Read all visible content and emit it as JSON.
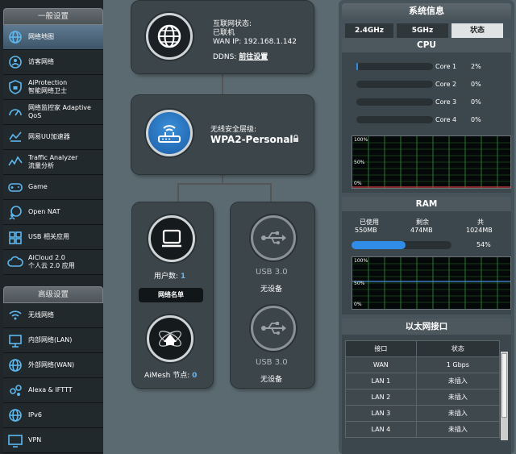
{
  "sidebar": {
    "general_header": "一般设置",
    "general_items": [
      {
        "label": "网络地图",
        "icon": "globe-icon",
        "active": true
      },
      {
        "label": "访客网络",
        "icon": "guest-network-icon"
      },
      {
        "label": "AiProtection",
        "label2": "智能网络卫士",
        "icon": "shield-lock-icon"
      },
      {
        "label": "网络监控家 Adaptive",
        "label2": "QoS",
        "icon": "gauge-icon"
      },
      {
        "label": "网易UU加速器",
        "icon": "uu-accelerator-icon"
      },
      {
        "label": "Traffic Analyzer",
        "label2": "流量分析",
        "icon": "traffic-icon"
      },
      {
        "label": "Game",
        "icon": "gamepad-icon"
      },
      {
        "label": "Open NAT",
        "icon": "globe-person-icon"
      },
      {
        "label": "USB 相关应用",
        "icon": "usb-puzzle-icon"
      },
      {
        "label": "AiCloud 2.0",
        "label2": "个人云 2.0 应用",
        "icon": "cloud-icon"
      }
    ],
    "advanced_header": "高级设置",
    "advanced_items": [
      {
        "label": "无线网络",
        "icon": "wifi-icon"
      },
      {
        "label": "内部网络(LAN)",
        "icon": "lan-icon"
      },
      {
        "label": "外部网络(WAN)",
        "icon": "wan-globe-icon"
      },
      {
        "label": "Alexa & IFTTT",
        "icon": "assistant-icon"
      },
      {
        "label": "IPv6",
        "icon": "ipv6-globe-icon"
      },
      {
        "label": "VPN",
        "icon": "vpn-monitor-icon"
      }
    ]
  },
  "internet": {
    "status_label": "互联网状态:",
    "status_value": "已联机",
    "wan_ip_label": "WAN IP:",
    "wan_ip": "192.168.1.142",
    "ddns_label": "DDNS:",
    "ddns_link": "前往设置"
  },
  "router": {
    "security_label": "无线安全层级:",
    "security_value": "WPA2-Personal"
  },
  "clients": {
    "count_label": "用户数:",
    "count": "1",
    "list_button": "网络名单",
    "aimesh_label": "AiMesh 节点:",
    "aimesh_count": "0"
  },
  "usb": [
    {
      "title": "USB 3.0",
      "status": "无设备"
    },
    {
      "title": "USB 3.0",
      "status": "无设备"
    }
  ],
  "system": {
    "header": "系统信息",
    "tabs": [
      "2.4GHz",
      "5GHz",
      "状态"
    ],
    "selected_tab": 2,
    "cpu_title": "CPU",
    "cores": [
      {
        "name": "Core 1",
        "pct": "2%",
        "fill": 0.02
      },
      {
        "name": "Core 2",
        "pct": "0%",
        "fill": 0
      },
      {
        "name": "Core 3",
        "pct": "0%",
        "fill": 0
      },
      {
        "name": "Core 4",
        "pct": "0%",
        "fill": 0
      }
    ],
    "graph_ticks": [
      "100%",
      "50%",
      "0%"
    ],
    "ram_title": "RAM",
    "ram_used_label": "已使用",
    "ram_used": "550MB",
    "ram_free_label": "剩余",
    "ram_free": "474MB",
    "ram_total_label": "共",
    "ram_total": "1024MB",
    "ram_pct": "54%",
    "ram_fill": 0.54,
    "eth_title": "以太网接口",
    "eth_headers": [
      "接口",
      "状态"
    ],
    "eth_rows": [
      [
        "WAN",
        "1 Gbps"
      ],
      [
        "LAN 1",
        "未插入"
      ],
      [
        "LAN 2",
        "未插入"
      ],
      [
        "LAN 3",
        "未插入"
      ],
      [
        "LAN 4",
        "未插入"
      ]
    ]
  },
  "colors": {
    "accent": "#3a8fd8",
    "value_blue": "#6ab4f0",
    "graph_green": "#3ea83e"
  }
}
